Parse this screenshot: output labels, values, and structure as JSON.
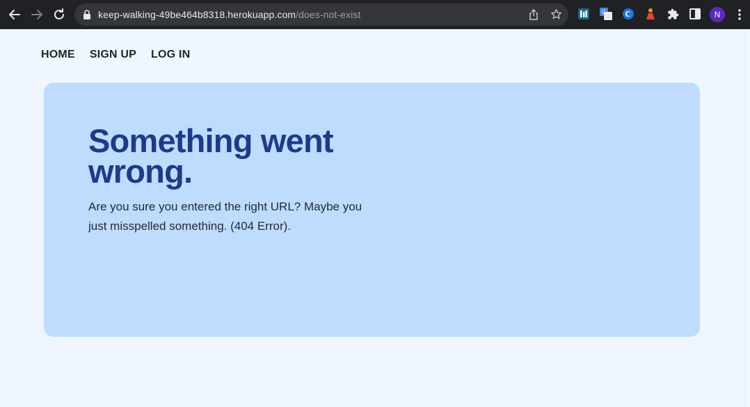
{
  "browser": {
    "url_host": "keep-walking-49be464b8318.herokuapp.com",
    "url_path": "/does-not-exist",
    "profile_initial": "N",
    "icons": [
      "back-arrow-icon",
      "forward-arrow-icon",
      "reload-icon",
      "lock-icon",
      "share-icon",
      "star-icon",
      "extension-icon",
      "translate-icon",
      "puzzle-icon",
      "side-panel-icon",
      "menu-icon"
    ]
  },
  "nav": {
    "home": "HOME",
    "signup": "SIGN UP",
    "login": "LOG IN"
  },
  "error": {
    "title": "Something went wrong.",
    "message": "Are you sure you entered the right URL? Maybe you just misspelled something. (404 Error)."
  },
  "colors": {
    "page_bg": "#eff6ff",
    "card_bg": "#bfdbfe",
    "title": "#1e3a8a"
  }
}
